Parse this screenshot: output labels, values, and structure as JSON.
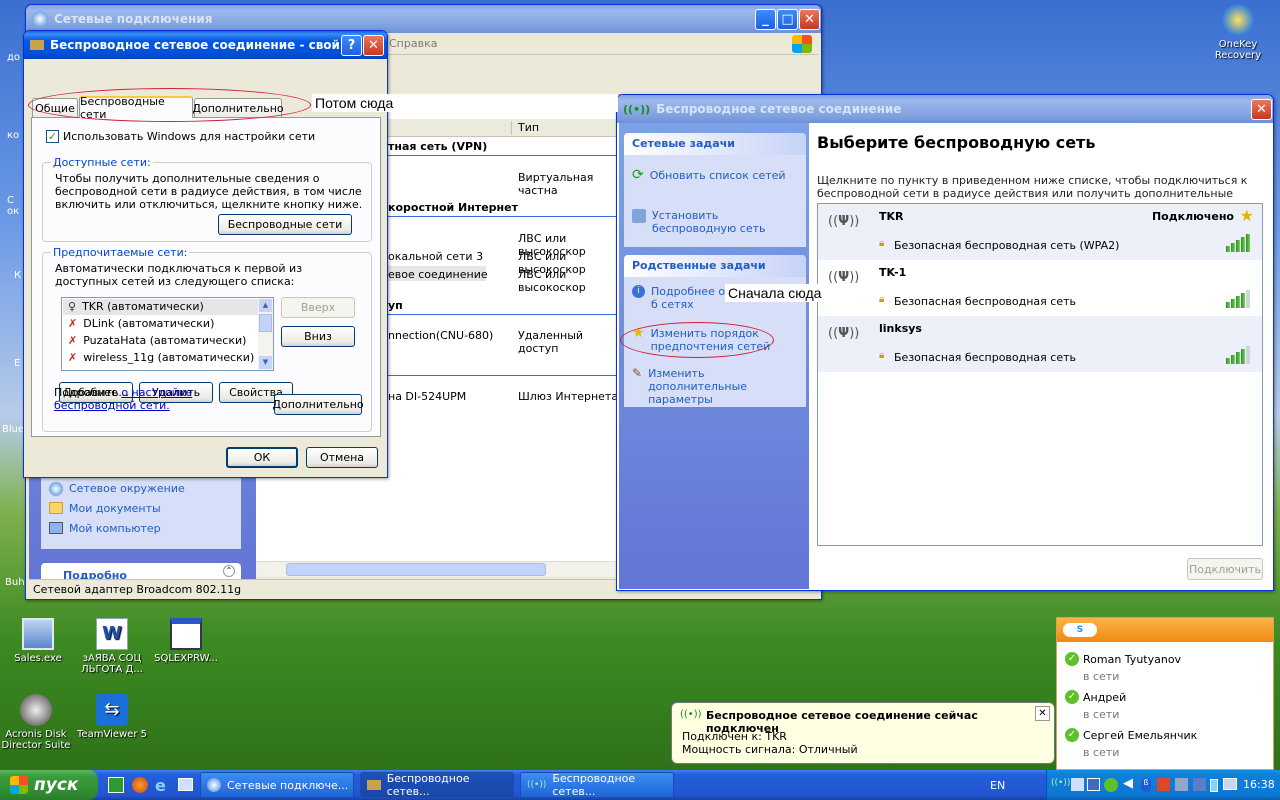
{
  "desktop_icons": [
    {
      "label": "OneKey Recovery"
    },
    {
      "label": "Sales.exe"
    },
    {
      "label": "зАЯВА СОЦ ЛЬГОТА Д..."
    },
    {
      "label": "SQLEXPRW..."
    },
    {
      "label": "Acronis Disk Director Suite"
    },
    {
      "label": "TeamViewer 5"
    }
  ],
  "edge_labels": [
    "до",
    "ко",
    "С ок",
    "К",
    "Blue",
    "Buh",
    "Е"
  ],
  "net_window": {
    "title": "Сетевые подключения",
    "menu_help": "Справка",
    "col_type": "Тип",
    "sections": [
      "тная сеть (VPN)",
      "коростной Интернет",
      "уп"
    ],
    "rows": [
      {
        "name": "",
        "type": "Виртуальная частна"
      },
      {
        "name": "окальной сети 3",
        "type": "ЛВС или высокоскор"
      },
      {
        "name": "",
        "type": "ЛВС или высокоскор"
      },
      {
        "name": "евое соединение",
        "type": "ЛВС или высокоскор"
      },
      {
        "name": "nnection(CNU-680)",
        "type": "Удаленный доступ"
      },
      {
        "name": "на DI-524UPM",
        "type": "Шлюз Интернета"
      }
    ],
    "other_places": [
      "Сетевое окружение",
      "Мои документы",
      "Мой компьютер"
    ],
    "status": "Сетевой адаптер Broadcom 802.11g",
    "cut_text": "Подробно"
  },
  "props": {
    "title": "Беспроводное сетевое соединение - свой...",
    "tabs": [
      "Общие",
      "Беспроводные сети",
      "Дополнительно"
    ],
    "use_windows": "Использовать Windows для настройки сети",
    "available_label": "Доступные сети:",
    "available_text": "Чтобы получить дополнительные сведения о беспроводной сети в радиусе действия, в том числе включить или отключиться, щелкните кнопку ниже.",
    "wireless_btn": "Беспроводные сети",
    "preferred_label": "Предпочитаемые сети:",
    "preferred_text": "Автоматически подключаться к первой из доступных сетей из следующего списка:",
    "list": [
      "TKR (автоматически)",
      "DLink (автоматически)",
      "PuzataHata (автоматически)",
      "wireless_11g (автоматически)"
    ],
    "up_btn": "Вверх",
    "down_btn": "Вниз",
    "add_btn": "Добавить...",
    "remove_btn": "Удалить",
    "props_btn": "Свойства",
    "more_pre": "Подробнее ",
    "more_link": "о настройке беспроводной сети.",
    "advanced_btn": "Дополнительно",
    "ok": "ОК",
    "cancel": "Отмена"
  },
  "wifi": {
    "title": "Беспроводное сетевое соединение",
    "net_tasks_title": "Сетевые задачи",
    "refresh": "Обновить список сетей",
    "setup": "Установить беспроводную сеть",
    "related_title": "Родственные задачи",
    "related_more": "Подробнее о б сетях",
    "change_order": "Изменить порядок предпочтения сетей",
    "change_adv": "Изменить дополнительные параметры",
    "heading": "Выберите беспроводную сеть",
    "desc": "Щелкните по пункту в приведенном ниже списке, чтобы подключиться к беспроводной сети в радиусе действия или получить дополнительные сведения.",
    "networks": [
      {
        "name": "TKR",
        "security": "Безопасная беспроводная сеть (WPA2)",
        "status": "Подключено",
        "signal": 1.0
      },
      {
        "name": "TK-1",
        "security": "Безопасная беспроводная сеть",
        "status": "",
        "signal": 0.8
      },
      {
        "name": "linksys",
        "security": "Безопасная беспроводная сеть",
        "status": "",
        "signal": 0.8
      }
    ],
    "connect_btn": "Подключить"
  },
  "annotations": {
    "second": "Потом сюда",
    "first": "Сначала сюда"
  },
  "skype": {
    "contacts": [
      {
        "name": "Roman Tyutyanov",
        "status": "в сети"
      },
      {
        "name": "Андрей",
        "status": "в сети"
      },
      {
        "name": "Сергей Емельянчик",
        "status": "в сети"
      }
    ]
  },
  "balloon": {
    "title": "Беспроводное сетевое соединение сейчас подключен",
    "line1": "Подключен к: TKR",
    "line2": "Мощность сигнала: Отличный"
  },
  "taskbar": {
    "start": "пуск",
    "buttons": [
      "Сетевые подключе...",
      "Беспроводное сетев...",
      "Беспроводное сетев..."
    ],
    "lang": "EN",
    "clock": "16:38"
  },
  "colors": {
    "title_active": "#0054e3",
    "skype_orange": "#f7941d",
    "link": "#215dc6",
    "annotation_oval": "#d0203a"
  }
}
